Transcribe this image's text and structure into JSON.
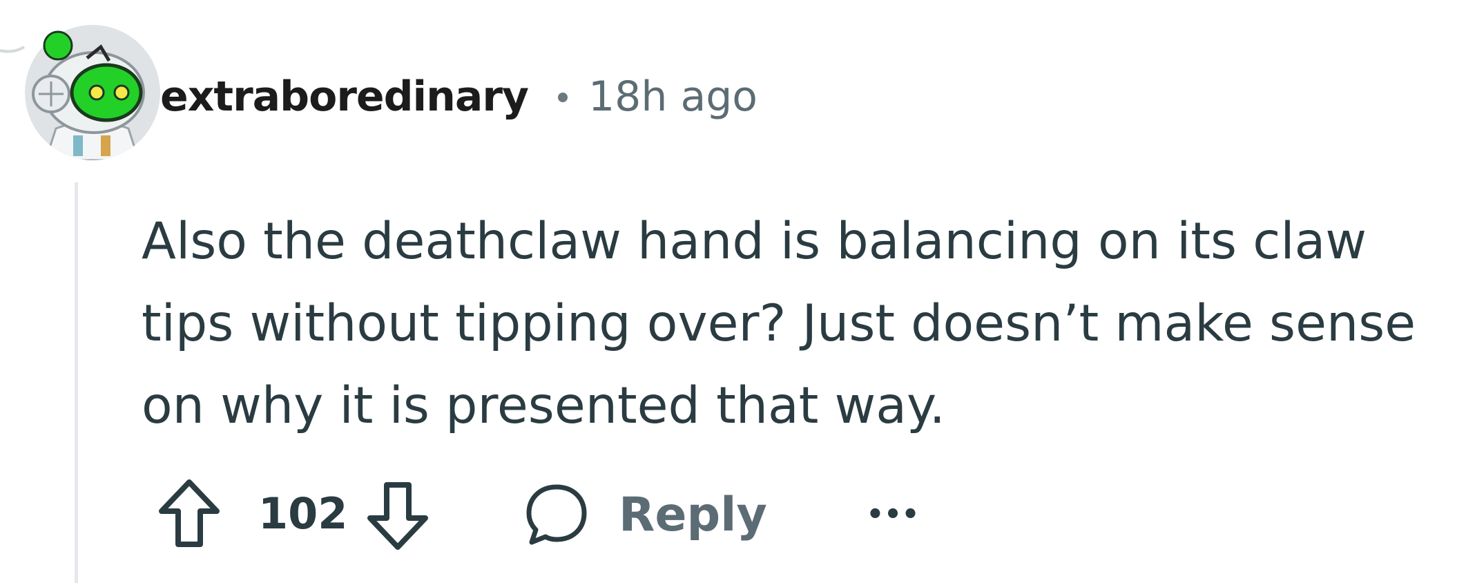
{
  "comment": {
    "author": "extraboredinary",
    "separator": "•",
    "time_ago": "18h ago",
    "body": "Also the deathclaw hand is balancing on its claw tips without tipping over? Just doesn’t make sense on why it is presented that way.",
    "avatar_icon": "snoo-astronaut-avatar",
    "actions": {
      "upvote_icon": "upvote-arrow-icon",
      "vote_count": "102",
      "downvote_icon": "downvote-arrow-icon",
      "reply_icon": "speech-bubble-icon",
      "reply_label": "Reply",
      "more_label": "•••"
    }
  },
  "colors": {
    "text_primary": "#1c1c1c",
    "text_body": "#2a3c42",
    "text_muted": "#5c6c74",
    "thread_line": "#e5e8ea",
    "avatar_green": "#26d02a"
  }
}
